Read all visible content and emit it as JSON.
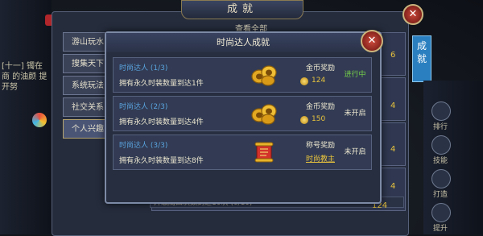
{
  "window": {
    "title": "成就",
    "side_tab": "成就"
  },
  "left_text": "[十一] 镯在商 的油颜 提开努",
  "categories": [
    {
      "label": "游山玩水",
      "active": false
    },
    {
      "label": "搜集天下",
      "active": false
    },
    {
      "label": "系统玩法",
      "active": false
    },
    {
      "label": "社交关系",
      "active": false
    },
    {
      "label": "个人兴趣",
      "active": true
    }
  ],
  "background": {
    "top_link": "查看全部",
    "bottom_strip": "升级局四次数到达10次 (0/10)",
    "reward_numbers": [
      "6",
      "4",
      "4",
      "4",
      "124"
    ]
  },
  "right_bar": {
    "items": [
      "排行",
      "技能",
      "打造",
      "提升"
    ]
  },
  "modal": {
    "title": "时尚达人成就",
    "rows": [
      {
        "name": "时尚达人",
        "progress": "(1/3)",
        "desc": "拥有永久时装数量到达1件",
        "reward_type": "金币奖励",
        "reward_value": "124",
        "status": "进行中",
        "status_kind": "progress"
      },
      {
        "name": "时尚达人",
        "progress": "(2/3)",
        "desc": "拥有永久时装数量到达4件",
        "reward_type": "金币奖励",
        "reward_value": "150",
        "status": "未开启",
        "status_kind": "locked"
      },
      {
        "name": "时尚达人",
        "progress": "(3/3)",
        "desc": "拥有永久时装数量到达8件",
        "reward_type": "称号奖励",
        "reward_value": "时尚教主",
        "status": "未开启",
        "status_kind": "locked"
      }
    ]
  },
  "icons": {
    "close": "close-icon",
    "coin": "coin-icon",
    "gold_pile": "gold-pile-icon",
    "scroll": "scroll-icon"
  },
  "colors": {
    "progress_status": "#76d14a",
    "row_title": "#5aa3df",
    "reward_value": "#e8c23e"
  }
}
